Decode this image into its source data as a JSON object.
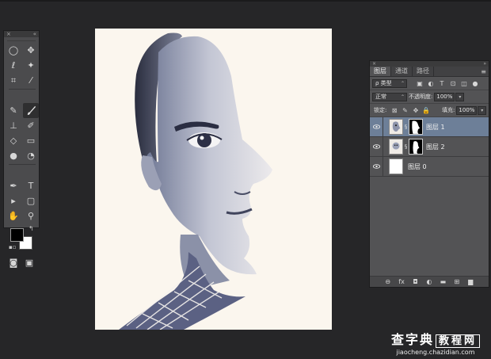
{
  "tool_panel": {
    "collapse_glyph": "«",
    "close_glyph": "×",
    "tools": [
      {
        "icon": "elliptical-marquee-icon",
        "glyph": "◯"
      },
      {
        "icon": "move-icon",
        "glyph": "✥"
      },
      {
        "icon": "lasso-icon",
        "glyph": "ℓ"
      },
      {
        "icon": "magic-wand-icon",
        "glyph": "✦"
      },
      {
        "icon": "crop-icon",
        "glyph": "⌗"
      },
      {
        "icon": "eyedropper-icon",
        "glyph": "⁄"
      },
      {
        "icon": "spot-healing-icon",
        "glyph": "✎"
      },
      {
        "icon": "brush-icon",
        "glyph": "🖌"
      },
      {
        "icon": "clone-stamp-icon",
        "glyph": "⊥"
      },
      {
        "icon": "history-brush-icon",
        "glyph": "✐"
      },
      {
        "icon": "eraser-icon",
        "glyph": "◇"
      },
      {
        "icon": "gradient-icon",
        "glyph": "▭"
      },
      {
        "icon": "blur-icon",
        "glyph": "●"
      },
      {
        "icon": "dodge-icon",
        "glyph": "◔"
      },
      {
        "icon": "pen-icon",
        "glyph": "✒"
      },
      {
        "icon": "type-icon",
        "glyph": "T"
      },
      {
        "icon": "path-selection-icon",
        "glyph": "▸"
      },
      {
        "icon": "rectangle-shape-icon",
        "glyph": "▢"
      },
      {
        "icon": "hand-icon",
        "glyph": "✋"
      },
      {
        "icon": "zoom-icon",
        "glyph": "⚲"
      }
    ],
    "foreground_color": "#000000",
    "background_color": "#ffffff",
    "quick_mask_glyph": "◙",
    "screen_mode_glyph": "▣"
  },
  "layers_panel": {
    "tabs": [
      "图层",
      "通道",
      "路径"
    ],
    "menu_glyph": "≡",
    "filter_label": "ρ 类型",
    "blend_mode": "正常",
    "opacity_label": "不透明度:",
    "opacity_value": "100%",
    "lock_label": "锁定:",
    "fill_label": "填充:",
    "fill_value": "100%",
    "layers": [
      {
        "name": "图层 1",
        "selected": true,
        "has_mask": true
      },
      {
        "name": "图层 2",
        "selected": false,
        "has_mask": true
      },
      {
        "name": "图层 0",
        "selected": false,
        "has_mask": false
      }
    ],
    "footer_icons": [
      "⊖",
      "fx",
      "◘",
      "◐",
      "▬",
      "⊞",
      "▆"
    ]
  },
  "watermark": {
    "line1_a": "查字典",
    "line1_b": "教程网",
    "line2": "jiaocheng.chazidian.com"
  },
  "colors": {
    "app_background": "#262628",
    "panel": "#535355",
    "selected_layer": "#6d7f98"
  }
}
